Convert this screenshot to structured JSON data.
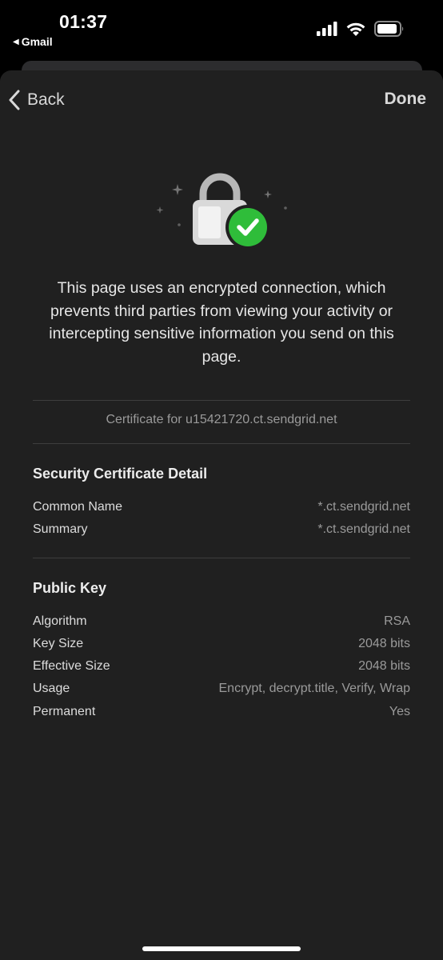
{
  "status_bar": {
    "time": "01:37",
    "back_app": "Gmail",
    "icons": [
      "cellular-signal-icon",
      "wifi-icon",
      "battery-icon"
    ]
  },
  "nav": {
    "back_label": "Back",
    "done_label": "Done"
  },
  "description": "This page uses an encrypted connection, which prevents third parties from viewing your activity or intercepting sensitive information you send on this page.",
  "certificate_for": "Certificate for u15421720.ct.sendgrid.net",
  "security_certificate": {
    "title": "Security Certificate Detail",
    "rows": [
      {
        "label": "Common Name",
        "value": "*.ct.sendgrid.net"
      },
      {
        "label": "Summary",
        "value": "*.ct.sendgrid.net"
      }
    ]
  },
  "public_key": {
    "title": "Public Key",
    "rows": [
      {
        "label": "Algorithm",
        "value": "RSA"
      },
      {
        "label": "Key Size",
        "value": "2048 bits"
      },
      {
        "label": "Effective Size",
        "value": "2048 bits"
      },
      {
        "label": "Usage",
        "value": "Encrypt, decrypt.title, Verify, Wrap"
      },
      {
        "label": "Permanent",
        "value": "Yes"
      }
    ]
  },
  "colors": {
    "sheet_background": "#202020",
    "check_green": "#2fbd3a",
    "lock_body": "#d9d9d9"
  }
}
